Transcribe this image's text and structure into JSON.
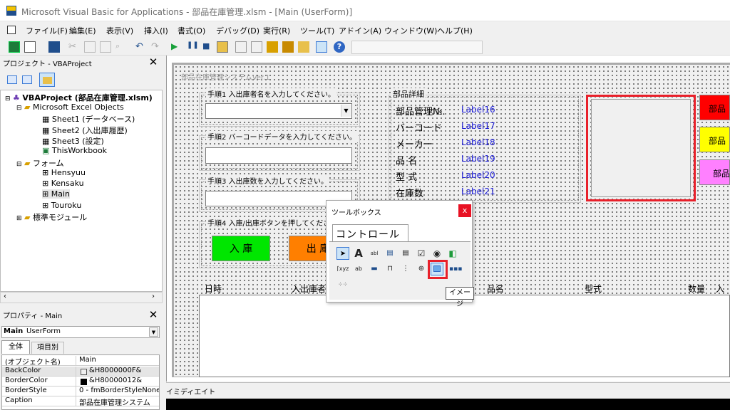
{
  "window": {
    "title": "Microsoft Visual Basic for Applications - 部品在庫管理.xlsm - [Main (UserForm)]"
  },
  "menu": [
    "ファイル(F)",
    "編集(E)",
    "表示(V)",
    "挿入(I)",
    "書式(O)",
    "デバッグ(D)",
    "実行(R)",
    "ツール(T)",
    "アドイン(A)",
    "ウィンドウ(W)",
    "ヘルプ(H)"
  ],
  "project": {
    "title": "プロジェクト - VBAProject",
    "root": "VBAProject (部品在庫管理.xlsm)",
    "excel_objects": "Microsoft Excel Objects",
    "sheets": [
      "Sheet1 (データベース)",
      "Sheet2 (入出庫履歴)",
      "Sheet3 (設定)",
      "ThisWorkbook"
    ],
    "forms_folder": "フォーム",
    "forms": [
      "Hensyuu",
      "Kensaku",
      "Main",
      "Touroku"
    ],
    "modules": "標準モジュール"
  },
  "properties": {
    "title": "プロパティ - Main",
    "object_name": "Main",
    "object_type": "UserForm",
    "tabs": [
      "全体",
      "項目別"
    ],
    "rows": [
      {
        "key": "(オブジェクト名)",
        "value": "Main"
      },
      {
        "key": "BackColor",
        "value": "&H8000000F&"
      },
      {
        "key": "BorderColor",
        "value": "&H80000012&"
      },
      {
        "key": "BorderStyle",
        "value": "0 - fmBorderStyleNone"
      },
      {
        "key": "Caption",
        "value": "部品在庫管理システム"
      }
    ]
  },
  "form": {
    "caption": "部品在庫管理システムVer.1",
    "step1": "手順1 入出庫者名を入力してください。",
    "step2": "手順2 バーコードデータを入力してください。",
    "step3": "手順3 入出庫数を入力してください。",
    "step4": "手順4 入庫/出庫ボタンを押してください。",
    "in_button": "入 庫",
    "out_button": "出 庫",
    "detail_title": "部品詳細",
    "detail_labels": [
      "部品管理№.",
      "バーコード",
      "メーカー",
      "品 名",
      "型 式",
      "在庫数"
    ],
    "detail_values": [
      "Label16",
      "Label17",
      "Label18",
      "Label19",
      "Label20",
      "Label21"
    ],
    "right_buttons": [
      "部品",
      "部品",
      "部品"
    ],
    "list_headers": [
      "日時",
      "入出庫者",
      "品名",
      "型式",
      "数量",
      "入出"
    ]
  },
  "toolbox": {
    "title": "ツールボックス",
    "close": "x",
    "tab": "コントロール",
    "tooltip": "イメージ"
  },
  "immediate": {
    "title": "イミディエイト"
  },
  "colors": {
    "highlight": "#e8202a",
    "in_button": "#00e600",
    "out_button": "#ff7f00"
  }
}
